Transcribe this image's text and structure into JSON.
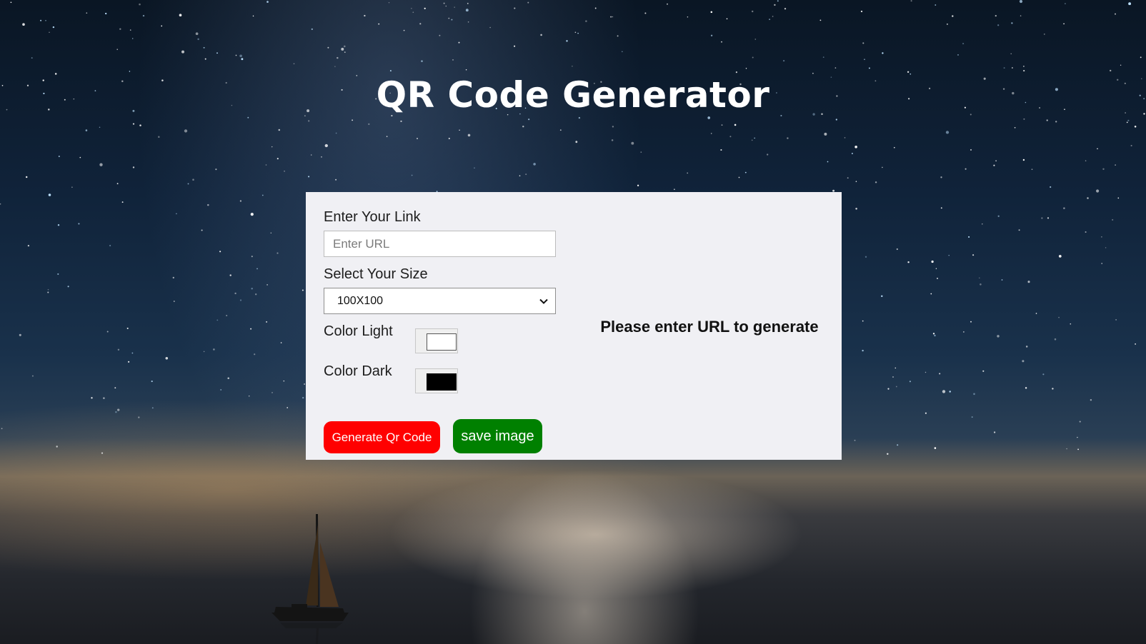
{
  "header": {
    "title": "QR Code Generator"
  },
  "form": {
    "link_label": "Enter Your Link",
    "url_placeholder": "Enter URL",
    "url_value": "",
    "size_label": "Select Your Size",
    "size_selected": "100X100",
    "color_light_label": "Color Light",
    "color_light_value": "#ffffff",
    "color_dark_label": "Color Dark",
    "color_dark_value": "#000000"
  },
  "buttons": {
    "generate_label": "Generate Qr Code",
    "save_label": "save image"
  },
  "output": {
    "message": "Please enter URL to generate"
  },
  "colors": {
    "generate_button": "#ff0000",
    "save_button": "#008000",
    "panel_background": "#f0f0f4"
  },
  "background": {
    "description_icon": "night-sky-sailboat-background"
  }
}
